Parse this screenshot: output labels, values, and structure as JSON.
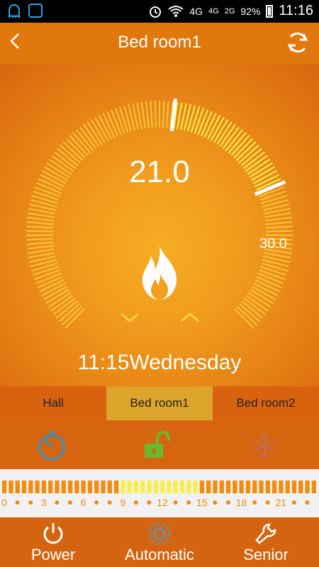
{
  "status_bar": {
    "network": "4G",
    "network_small_1": "4G",
    "network_small_2": "2G",
    "battery": "92%",
    "time": "11:16"
  },
  "header": {
    "title": "Bed room1"
  },
  "thermostat": {
    "current_temp": "21.0",
    "set_temp": "30.0",
    "current_value": 21.0,
    "set_value": 30.0,
    "datetime": "11:15Wednesday"
  },
  "rooms": [
    {
      "label": "Hall",
      "active": false
    },
    {
      "label": "Bed room1",
      "active": true
    },
    {
      "label": "Bed room2",
      "active": false
    }
  ],
  "schedule": {
    "hour_labels": [
      "0",
      "3",
      "6",
      "9",
      "12",
      "15",
      "18",
      "21"
    ],
    "active_range_hours": [
      9,
      15
    ]
  },
  "bottom_nav": {
    "power_label": "Power",
    "automatic_label": "Automatic",
    "senior_label": "Senior"
  },
  "colors": {
    "accent": "#e0780d",
    "highlight": "#f6f04d",
    "tab_active": "#dca42a"
  }
}
